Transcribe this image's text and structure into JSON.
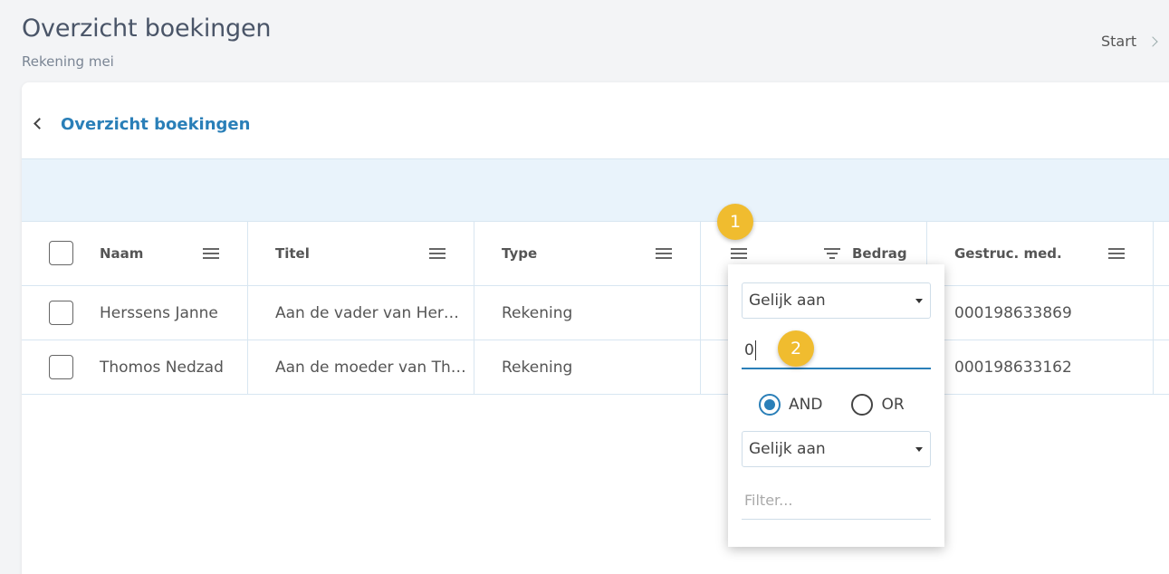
{
  "header": {
    "title": "Overzicht boekingen",
    "subtitle": "Rekening mei",
    "breadcrumb_label": "Start"
  },
  "card": {
    "title": "Overzicht boekingen"
  },
  "columns": {
    "naam": "Naam",
    "titel": "Titel",
    "type": "Type",
    "bedrag": "Bedrag",
    "gestruc": "Gestruc. med."
  },
  "rows": [
    {
      "naam": "Herssens Janne",
      "titel": "Aan de vader van Her…",
      "type": "Rekening",
      "gestruc": "000198633869"
    },
    {
      "naam": "Thomos Nedzad",
      "titel": "Aan de moeder van Th…",
      "type": "Rekening",
      "gestruc": "000198633162"
    }
  ],
  "filter_popup": {
    "condition1": "Gelijk aan",
    "value1": "0",
    "operator_and": "AND",
    "operator_or": "OR",
    "selected_operator": "AND",
    "condition2": "Gelijk aan",
    "value2_placeholder": "Filter..."
  },
  "badges": {
    "one": "1",
    "two": "2"
  },
  "colors": {
    "accent": "#2a7fb8",
    "badge": "#f0bc2f",
    "toolbar_bg": "#e9f3fb"
  }
}
